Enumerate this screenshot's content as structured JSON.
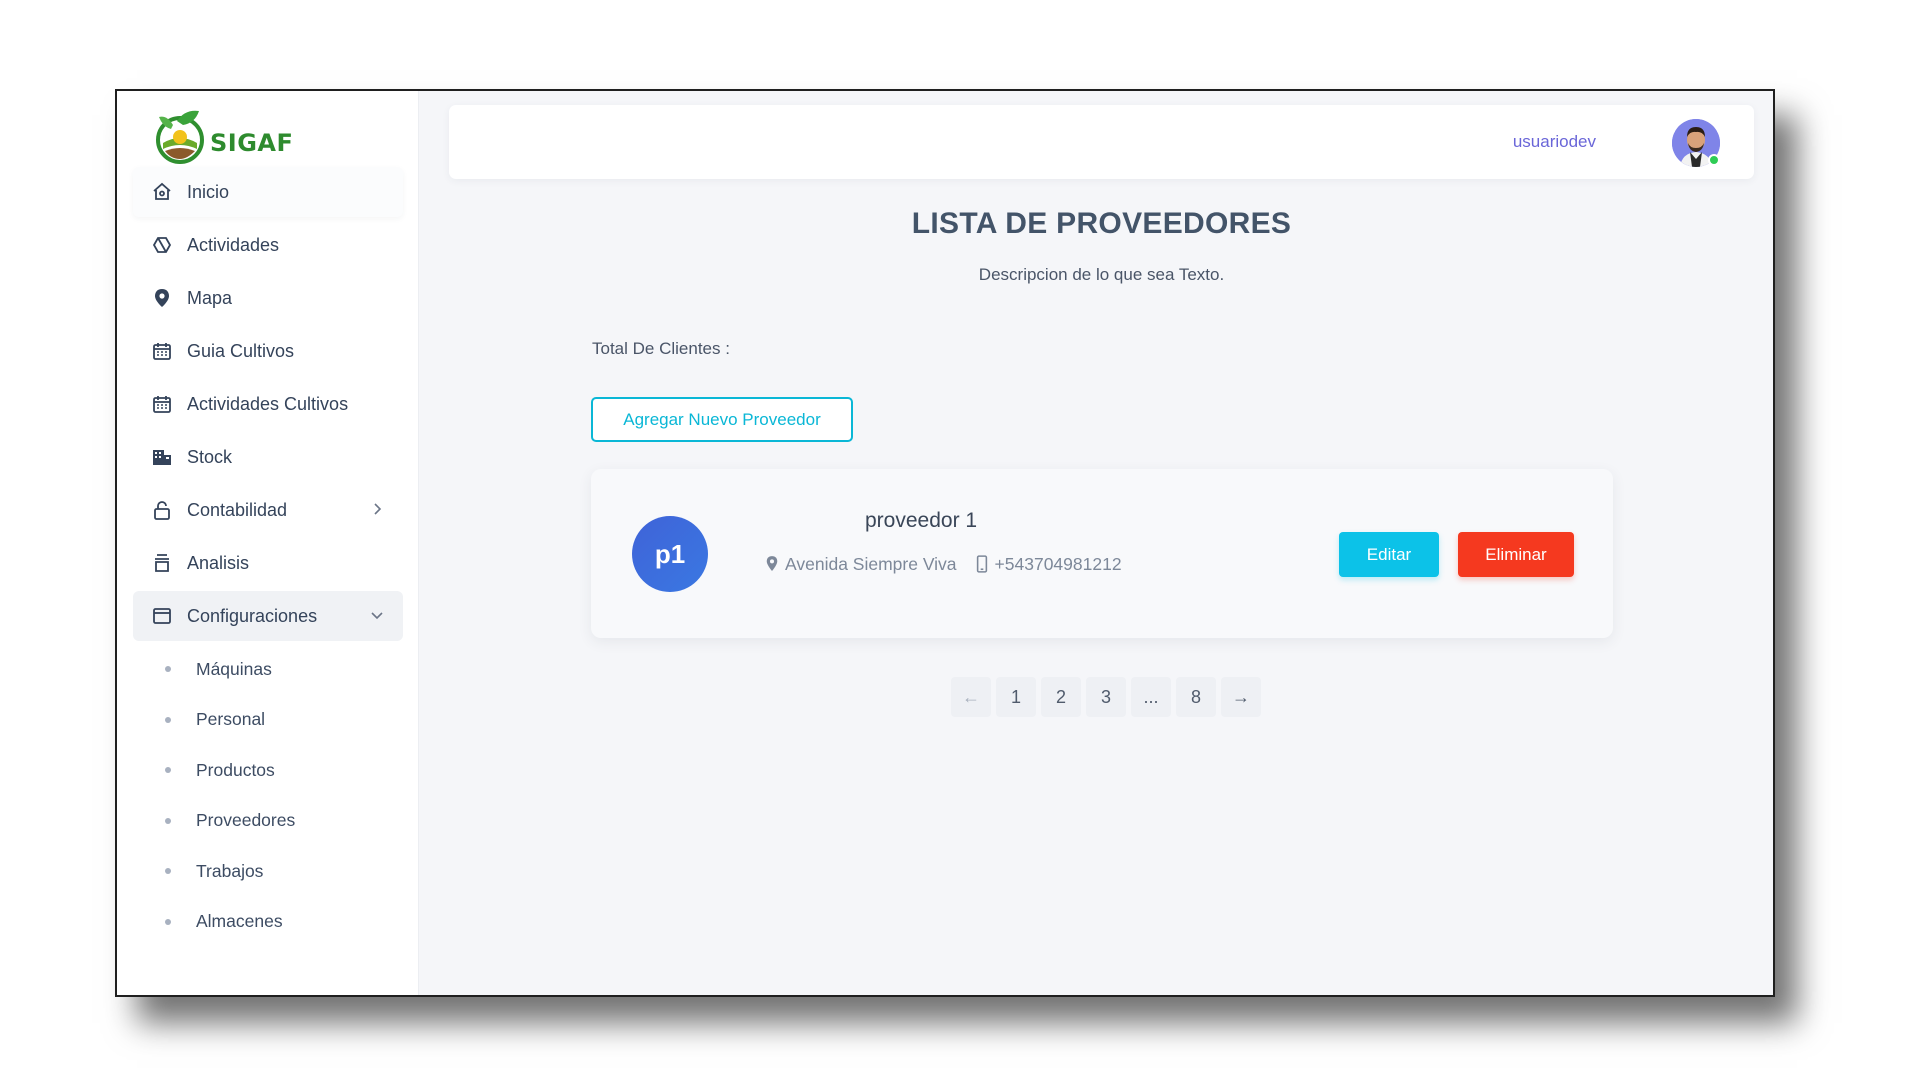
{
  "app": {
    "brand": "SIGAF"
  },
  "sidebar": {
    "items": [
      {
        "label": "Inicio",
        "icon": "home-icon"
      },
      {
        "label": "Actividades",
        "icon": "hexagon-icon"
      },
      {
        "label": "Mapa",
        "icon": "map-pin-icon"
      },
      {
        "label": "Guia Cultivos",
        "icon": "calendar-icon"
      },
      {
        "label": "Actividades Cultivos",
        "icon": "calendar-icon"
      },
      {
        "label": "Stock",
        "icon": "building-icon"
      },
      {
        "label": "Contabilidad",
        "icon": "lock-icon"
      },
      {
        "label": "Analisis",
        "icon": "trash-icon"
      },
      {
        "label": "Configuraciones",
        "icon": "window-icon"
      }
    ],
    "subitems": [
      "Máquinas",
      "Personal",
      "Productos",
      "Proveedores",
      "Trabajos",
      "Almacenes"
    ]
  },
  "topbar": {
    "username": "usuariodev"
  },
  "main": {
    "title": "LISTA DE PROVEEDORES",
    "description": "Descripcion de lo que sea Texto.",
    "total_label": "Total De Clientes :",
    "add_button": "Agregar Nuevo Proveedor"
  },
  "providers": [
    {
      "initials": "p1",
      "name": "proveedor 1",
      "address": "Avenida Siempre Viva",
      "phone": "+543704981212",
      "edit_label": "Editar",
      "delete_label": "Eliminar"
    }
  ],
  "pagination": {
    "prev": "←",
    "pages": [
      "1",
      "2",
      "3",
      "...",
      "8"
    ],
    "next": "→"
  },
  "colors": {
    "accent": "#0ab7d6",
    "danger": "#f5391f",
    "primary": "#3f63d8",
    "username": "#6a66d8",
    "brand_green": "#2e8b2e"
  }
}
